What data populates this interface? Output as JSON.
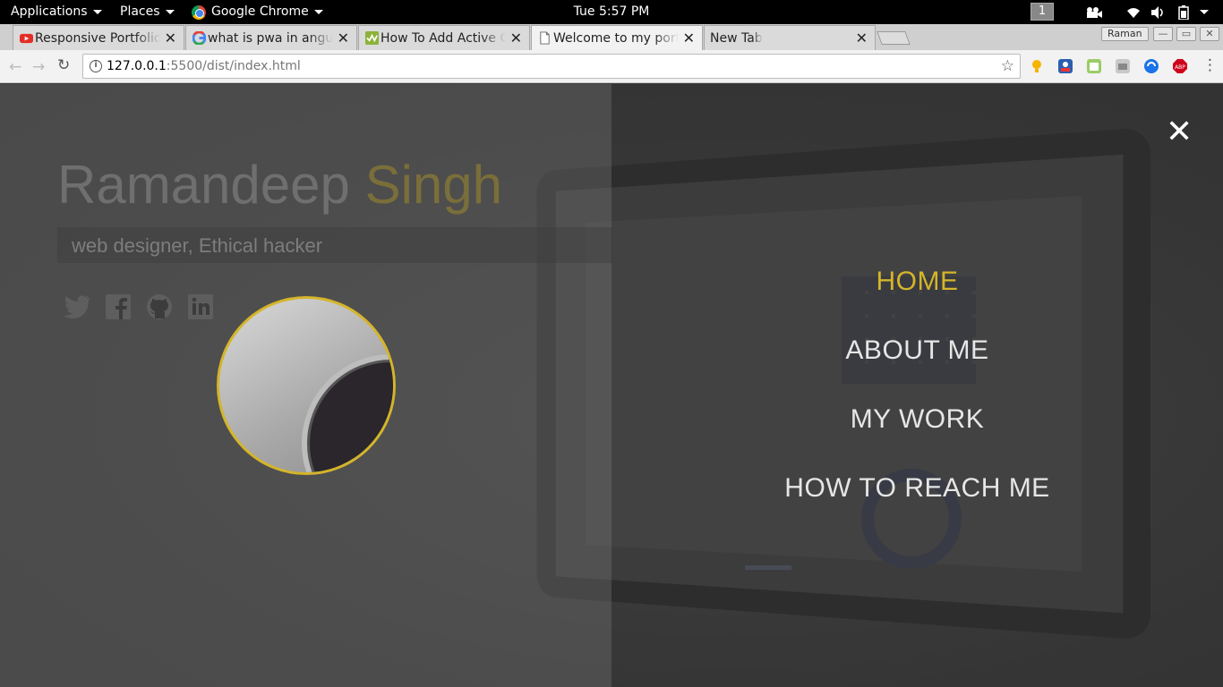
{
  "system_bar": {
    "applications": "Applications",
    "places": "Places",
    "browser": "Google Chrome",
    "clock": "Tue  5:57 PM",
    "workspace": "1"
  },
  "tabs": [
    {
      "title": "Responsive Portfolio",
      "favicon": "youtube-icon",
      "active": false
    },
    {
      "title": "what is pwa in angular",
      "favicon": "google-icon",
      "active": false
    },
    {
      "title": "How To Add Active C",
      "favicon": "site-icon",
      "active": false
    },
    {
      "title": "Welcome to my portfolio",
      "favicon": "document-icon",
      "active": true
    },
    {
      "title": "New Tab",
      "favicon": "",
      "active": false
    }
  ],
  "profile_name": "Raman",
  "address_bar": {
    "host": "127.0.0.1",
    "path": ":5500/dist/index.html"
  },
  "colors": {
    "accent": "#d4b52a",
    "menu_text": "#e6e6e6"
  },
  "hero": {
    "first_name": "Ramandeep",
    "last_name": "Singh",
    "subtitle": "web designer, Ethical hacker",
    "social": [
      "twitter-icon",
      "facebook-icon",
      "github-icon",
      "linkedin-icon"
    ]
  },
  "nav": {
    "items": [
      {
        "label": "HOME",
        "active": true
      },
      {
        "label": "ABOUT ME",
        "active": false
      },
      {
        "label": "MY WORK",
        "active": false
      },
      {
        "label": "HOW TO REACH ME",
        "active": false
      }
    ],
    "close_glyph": "✕"
  }
}
